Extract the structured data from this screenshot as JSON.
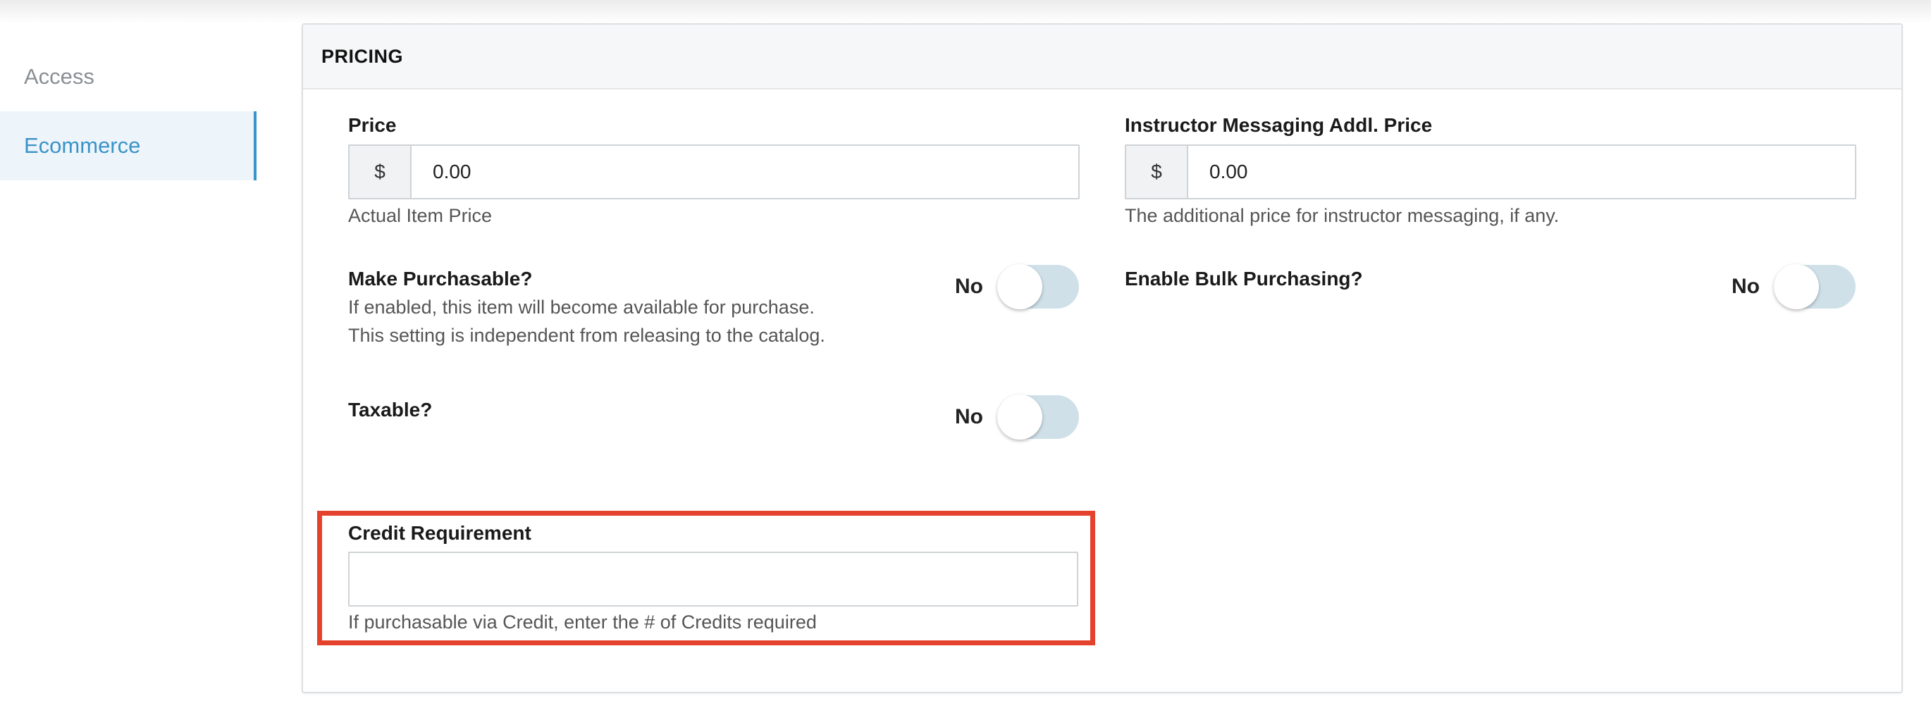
{
  "sidebar": {
    "items": [
      {
        "label": "Access"
      },
      {
        "label": "Ecommerce"
      }
    ]
  },
  "panel": {
    "title": "PRICING"
  },
  "price": {
    "label": "Price",
    "currency": "$",
    "value": "0.00",
    "help": "Actual Item Price"
  },
  "instructor_price": {
    "label": "Instructor Messaging Addl. Price",
    "currency": "$",
    "value": "0.00",
    "help": "The additional price for instructor messaging, if any."
  },
  "purchasable": {
    "label": "Make Purchasable?",
    "help_line1": "If enabled, this item will become available for purchase.",
    "help_line2": "This setting is independent from releasing to the catalog.",
    "state": "No"
  },
  "bulk": {
    "label": "Enable Bulk Purchasing?",
    "state": "No"
  },
  "taxable": {
    "label": "Taxable?",
    "state": "No"
  },
  "credit": {
    "label": "Credit Requirement",
    "value": "",
    "help": "If purchasable via Credit, enter the # of Credits required"
  },
  "colors": {
    "accent": "#3a93c8",
    "highlight": "#e4422c",
    "toggle_off": "#cfe0e9"
  }
}
